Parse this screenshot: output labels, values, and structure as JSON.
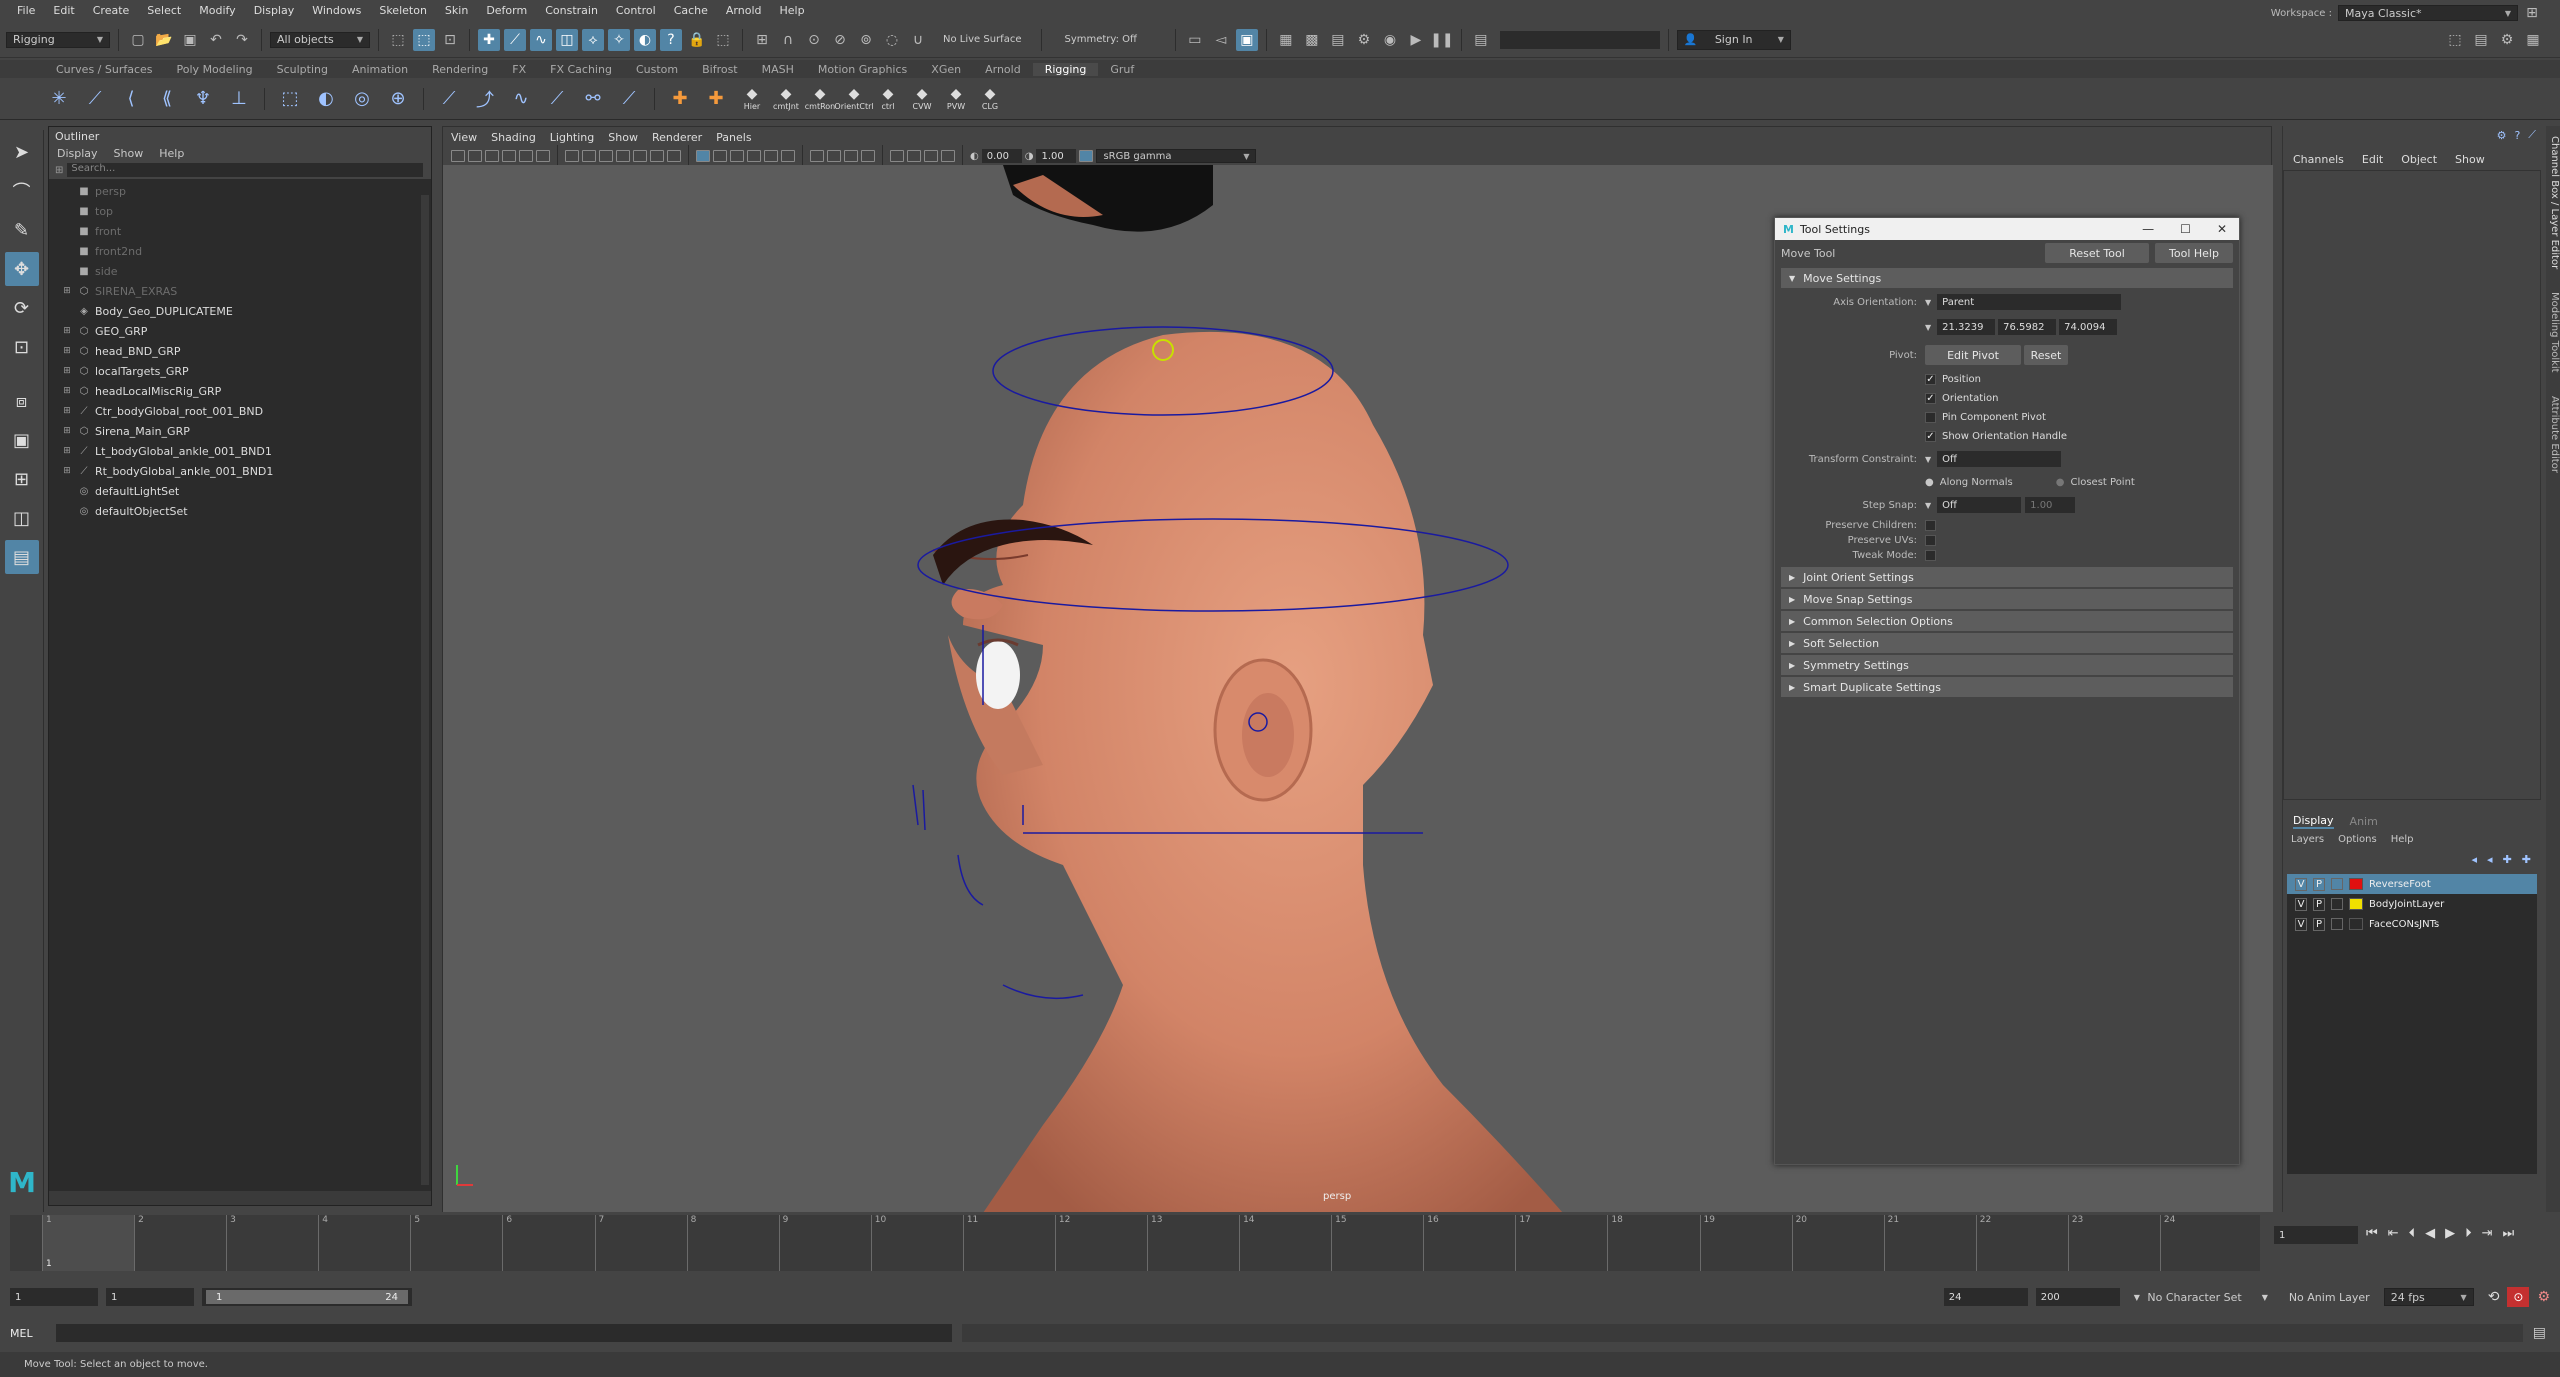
{
  "menubar": {
    "items": [
      "File",
      "Edit",
      "Create",
      "Select",
      "Modify",
      "Display",
      "Windows",
      "Skeleton",
      "Skin",
      "Deform",
      "Constrain",
      "Control",
      "Cache",
      "Arnold",
      "Help"
    ],
    "workspace_label": "Workspace :",
    "workspace_value": "Maya Classic*"
  },
  "statusline": {
    "mode": "Rigging",
    "select_mode": "All objects",
    "live_surface": "No Live Surface",
    "symmetry": "Symmetry: Off",
    "sign_in": "Sign In"
  },
  "shelf": {
    "tabs": [
      "Curves / Surfaces",
      "Poly Modeling",
      "Sculpting",
      "Animation",
      "Rendering",
      "FX",
      "FX Caching",
      "Custom",
      "Bifrost",
      "MASH",
      "Motion Graphics",
      "XGen",
      "Arnold",
      "Rigging",
      "Gruf"
    ],
    "active_tab": "Rigging",
    "custom_icons": [
      "Hier",
      "cmtJnt",
      "cmtRon",
      "OrientCtrl",
      "ctrl",
      "CVW",
      "PVW",
      "CLG"
    ]
  },
  "outliner": {
    "title": "Outliner",
    "menus": [
      "Display",
      "Show",
      "Help"
    ],
    "search_placeholder": "Search...",
    "items": [
      {
        "label": "persp",
        "dim": true,
        "expand": false,
        "icon": "cam"
      },
      {
        "label": "top",
        "dim": true,
        "expand": false,
        "icon": "cam"
      },
      {
        "label": "front",
        "dim": true,
        "expand": false,
        "icon": "cam"
      },
      {
        "label": "front2nd",
        "dim": true,
        "expand": false,
        "icon": "cam"
      },
      {
        "label": "side",
        "dim": true,
        "expand": false,
        "icon": "cam"
      },
      {
        "label": "SIRENA_EXRAS",
        "dim": true,
        "expand": true,
        "icon": "grp"
      },
      {
        "label": "Body_Geo_DUPLICATEME",
        "dim": false,
        "expand": false,
        "icon": "mesh"
      },
      {
        "label": "GEO_GRP",
        "dim": false,
        "expand": true,
        "icon": "grp"
      },
      {
        "label": "head_BND_GRP",
        "dim": false,
        "expand": true,
        "icon": "grp"
      },
      {
        "label": "localTargets_GRP",
        "dim": false,
        "expand": true,
        "icon": "grp"
      },
      {
        "label": "headLocalMiscRig_GRP",
        "dim": false,
        "expand": true,
        "icon": "grp"
      },
      {
        "label": "Ctr_bodyGlobal_root_001_BND",
        "dim": false,
        "expand": true,
        "icon": "jnt"
      },
      {
        "label": "Sirena_Main_GRP",
        "dim": false,
        "expand": true,
        "icon": "grp"
      },
      {
        "label": "Lt_bodyGlobal_ankle_001_BND1",
        "dim": false,
        "expand": true,
        "icon": "jnt"
      },
      {
        "label": "Rt_bodyGlobal_ankle_001_BND1",
        "dim": false,
        "expand": true,
        "icon": "jnt"
      },
      {
        "label": "defaultLightSet",
        "dim": false,
        "expand": false,
        "icon": "set"
      },
      {
        "label": "defaultObjectSet",
        "dim": false,
        "expand": false,
        "icon": "set"
      }
    ]
  },
  "viewport": {
    "menus": [
      "View",
      "Shading",
      "Lighting",
      "Show",
      "Renderer",
      "Panels"
    ],
    "exposure": "0.00",
    "gamma": "1.00",
    "color_space": "sRGB gamma",
    "camera_label": "persp"
  },
  "tool_settings": {
    "title": "Tool Settings",
    "tool_name": "Move Tool",
    "reset_label": "Reset Tool",
    "help_label": "Tool Help",
    "move_settings_label": "Move Settings",
    "axis_orientation_label": "Axis Orientation:",
    "axis_orientation_value": "Parent",
    "axis_values": [
      "21.3239",
      "76.5982",
      "74.0094"
    ],
    "pivot_label": "Pivot:",
    "edit_pivot": "Edit Pivot",
    "reset": "Reset",
    "checks": [
      {
        "label": "Position",
        "checked": true
      },
      {
        "label": "Orientation",
        "checked": true
      },
      {
        "label": "Pin Component Pivot",
        "checked": false
      },
      {
        "label": "Show Orientation Handle",
        "checked": true
      }
    ],
    "transform_constraint_label": "Transform Constraint:",
    "transform_constraint_value": "Off",
    "along_normals": "Along Normals",
    "closest_point": "Closest Point",
    "step_snap_label": "Step Snap:",
    "step_snap_value": "Off",
    "step_snap_amount": "1.00",
    "preserve_children": "Preserve Children:",
    "preserve_uvs": "Preserve UVs:",
    "tweak_mode": "Tweak Mode:",
    "sections": [
      "Joint Orient Settings",
      "Move Snap Settings",
      "Common Selection Options",
      "Soft Selection",
      "Symmetry Settings",
      "Smart Duplicate Settings"
    ]
  },
  "channel_box": {
    "menus": [
      "Channels",
      "Edit",
      "Object",
      "Show"
    ]
  },
  "layers": {
    "tabs": [
      "Display",
      "Anim"
    ],
    "menus": [
      "Layers",
      "Options",
      "Help"
    ],
    "rows": [
      {
        "v": "V",
        "p": "P",
        "name": "ReverseFoot",
        "color": "#e01010",
        "active": true
      },
      {
        "v": "V",
        "p": "P",
        "name": "BodyJointLayer",
        "color": "#f0e000",
        "active": false
      },
      {
        "v": "V",
        "p": "P",
        "name": "FaceCONsJNTs",
        "color": "",
        "active": false
      }
    ]
  },
  "side_tabs": [
    "Channel Box / Layer Editor",
    "Modeling Toolkit",
    "Attribute Editor"
  ],
  "timeline": {
    "ticks": [
      "1",
      "2",
      "3",
      "4",
      "5",
      "6",
      "7",
      "8",
      "9",
      "10",
      "11",
      "12",
      "13",
      "14",
      "15",
      "16",
      "17",
      "18",
      "19",
      "20",
      "21",
      "22",
      "23",
      "24"
    ],
    "current_frame": "1",
    "current_frame_field": "1"
  },
  "range": {
    "start": "1",
    "playback_start": "1",
    "slider_start": "1",
    "slider_end": "24",
    "playback_end": "24",
    "end": "200",
    "character_set": "No Character Set",
    "anim_layer": "No Anim Layer",
    "fps": "24 fps"
  },
  "cmdline": {
    "label": "MEL"
  },
  "helpline": {
    "text": "Move Tool: Select an object to move."
  }
}
